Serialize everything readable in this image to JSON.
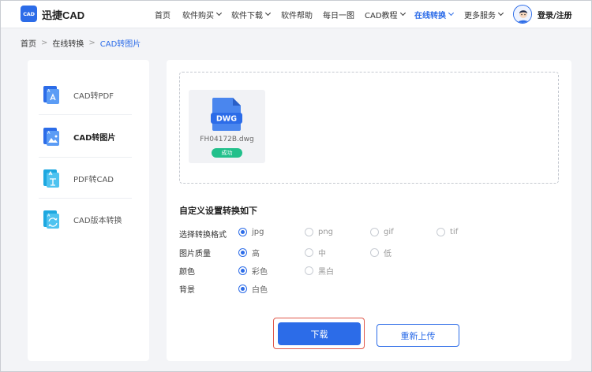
{
  "header": {
    "logo_icon_text": "CAD",
    "logo_text": "迅捷CAD",
    "nav": [
      {
        "label": "首页"
      },
      {
        "label": "软件购买"
      },
      {
        "label": "软件下载"
      },
      {
        "label": "软件帮助"
      },
      {
        "label": "每日一图"
      },
      {
        "label": "CAD教程"
      },
      {
        "label": "在线转换"
      },
      {
        "label": "更多服务"
      }
    ],
    "login": "登录/注册",
    "accent": "#2c6ce8"
  },
  "breadcrumb": {
    "items": [
      "首页",
      "在线转换",
      "CAD转图片"
    ],
    "separator": ">"
  },
  "sidebar": {
    "items": [
      {
        "label": "CAD转PDF",
        "icon": "cad-to-pdf-icon"
      },
      {
        "label": "CAD转图片",
        "icon": "cad-to-image-icon",
        "active": true
      },
      {
        "label": "PDF转CAD",
        "icon": "pdf-to-cad-icon"
      },
      {
        "label": "CAD版本转换",
        "icon": "cad-version-icon"
      }
    ]
  },
  "file": {
    "type_label": "DWG",
    "name": "FH04172B.dwg",
    "status": "成功",
    "status_color": "#22c08b"
  },
  "settings": {
    "title": "自定义设置转换如下",
    "format": {
      "label": "选择转换格式",
      "options": [
        "jpg",
        "png",
        "gif",
        "tif"
      ],
      "selected": "jpg"
    },
    "quality": {
      "label": "图片质量",
      "options": [
        "高",
        "中",
        "低"
      ],
      "selected": "高"
    },
    "color": {
      "label": "颜色",
      "options": [
        "彩色",
        "黑白"
      ],
      "selected": "彩色"
    },
    "background": {
      "label": "背景",
      "options": [
        "白色"
      ],
      "selected": "白色"
    }
  },
  "actions": {
    "download": "下载",
    "reupload": "重新上传",
    "highlight_color": "#e0584a"
  }
}
